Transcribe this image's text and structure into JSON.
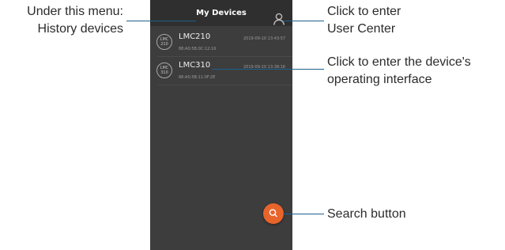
{
  "annotations": {
    "history_line1": "Under this menu:",
    "history_line2": "History devices",
    "user_center_line1": "Click to enter",
    "user_center_line2": "User Center",
    "device_line1": "Click to enter the device's",
    "device_line2": "operating interface",
    "search": "Search button"
  },
  "app": {
    "title": "My Devices"
  },
  "devices": [
    {
      "icon_line1": "LMC",
      "icon_line2": "210",
      "name": "LMC210",
      "mac": "88:A0:5B:0C:12:16",
      "timestamp": "2019-09-10 13:43:57"
    },
    {
      "icon_line1": "LMC",
      "icon_line2": "310",
      "name": "LMC310",
      "mac": "88:A0:5B:11:0F:2E",
      "timestamp": "2019-09-10 13:38:16"
    }
  ],
  "icons": {
    "user": "user-icon",
    "search": "search-icon"
  },
  "colors": {
    "phone_background": "#3d3d3d",
    "header_background": "#2f2f2f",
    "search_button": "#e8642b",
    "annotation_line": "#1e5f8c"
  }
}
